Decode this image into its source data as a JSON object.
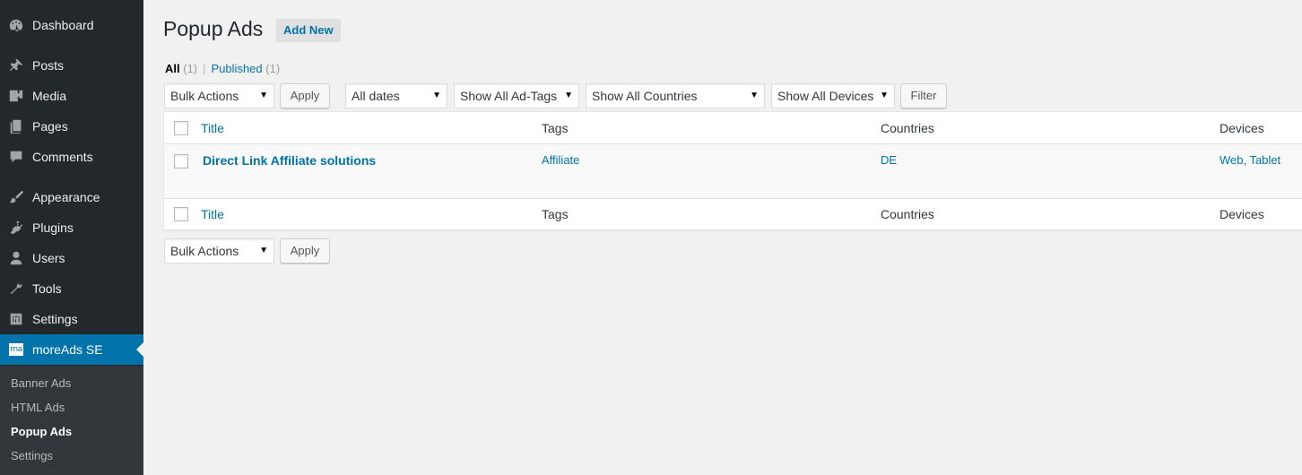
{
  "sidebar": {
    "items": [
      {
        "label": "Dashboard",
        "icon": "dashboard-icon"
      },
      {
        "label": "Posts",
        "icon": "pin-icon"
      },
      {
        "label": "Media",
        "icon": "media-icon"
      },
      {
        "label": "Pages",
        "icon": "pages-icon"
      },
      {
        "label": "Comments",
        "icon": "comment-icon"
      },
      {
        "label": "Appearance",
        "icon": "brush-icon"
      },
      {
        "label": "Plugins",
        "icon": "plug-icon"
      },
      {
        "label": "Users",
        "icon": "user-icon"
      },
      {
        "label": "Tools",
        "icon": "wrench-icon"
      },
      {
        "label": "Settings",
        "icon": "settings-sliders-icon"
      },
      {
        "label": "moreAds SE",
        "icon": "moreads-logo-icon",
        "logo_text": "ma"
      }
    ],
    "submenu": [
      "Banner Ads",
      "HTML Ads",
      "Popup Ads",
      "Settings"
    ],
    "active_submenu": "Popup Ads"
  },
  "header": {
    "title": "Popup Ads",
    "add_new": "Add New"
  },
  "views": {
    "all_label": "All",
    "all_count": "(1)",
    "separator": "|",
    "published_label": "Published",
    "published_count": "(1)"
  },
  "filters": {
    "bulk_actions": "Bulk Actions",
    "apply": "Apply",
    "dates": "All dates",
    "tags": "Show All Ad-Tags",
    "countries": "Show All Countries",
    "devices": "Show All Devices",
    "filter": "Filter"
  },
  "table": {
    "columns": [
      "Title",
      "Tags",
      "Countries",
      "Devices"
    ],
    "rows": [
      {
        "title": "Direct Link Affiliate solutions",
        "tags": "Affiliate",
        "countries": "DE",
        "devices": "Web, Tablet"
      }
    ]
  },
  "bottom_actions": {
    "bulk_actions": "Bulk Actions",
    "apply": "Apply"
  },
  "colors": {
    "sidebar_bg": "#23282d",
    "accent": "#0073aa",
    "page_bg": "#f1f1f1"
  }
}
